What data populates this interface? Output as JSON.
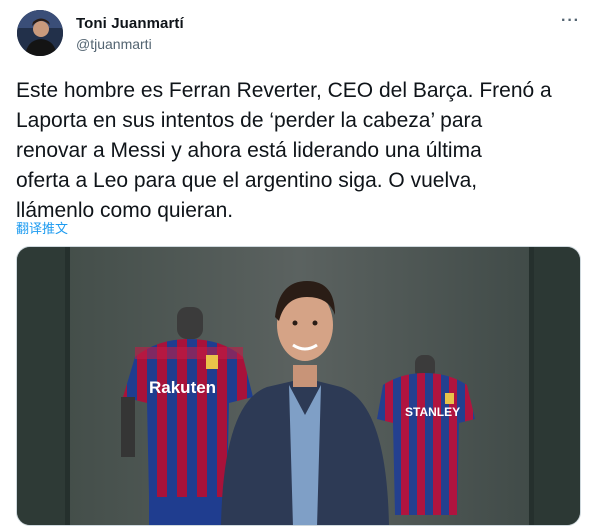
{
  "author": {
    "display_name": "Toni Juanmartí",
    "handle": "@tjuanmarti",
    "avatar_icon": "profile-photo"
  },
  "tweet": {
    "text_lines": [
      "Este hombre es Ferran Reverter, CEO del Barça. Frenó a",
      "Laporta en sus intentos de ‘perder la cabeza’ para",
      "renovar a Messi y ahora está liderando una última",
      "oferta a Leo para que el argentino siga. O vuelva,",
      "llámenlo como quieran."
    ],
    "translate_label": "翻译推文",
    "more_icon": "more-icon"
  },
  "media": {
    "left_shirt_sponsor": "Rakuten",
    "right_shirt_sponsor": "STANLEY"
  },
  "colors": {
    "link": "#1d9bf0",
    "handle": "#536471",
    "text": "#0f1419"
  }
}
